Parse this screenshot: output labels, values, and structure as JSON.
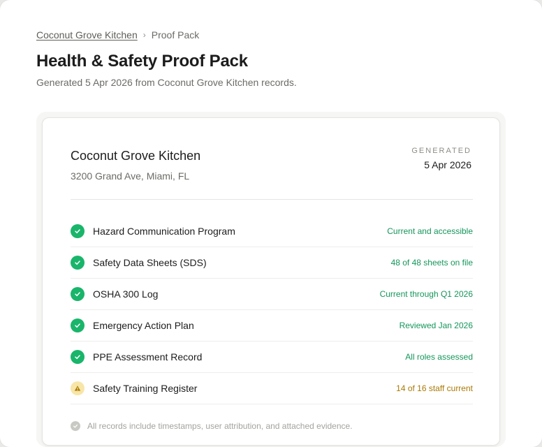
{
  "breadcrumb": {
    "parent": "Coconut Grove Kitchen",
    "separator": "›",
    "current": "Proof Pack"
  },
  "header": {
    "title": "Health & Safety Proof Pack",
    "subtitle": "Generated 5 Apr 2026 from Coconut Grove Kitchen records."
  },
  "card": {
    "name": "Coconut Grove Kitchen",
    "address": "3200 Grand Ave, Miami, FL",
    "generated_label": "GENERATED",
    "generated_date": "5 Apr 2026",
    "items": [
      {
        "label": "Hazard Communication Program",
        "status": "Current and accessible",
        "state": "ok",
        "icon": "check-icon"
      },
      {
        "label": "Safety Data Sheets (SDS)",
        "status": "48 of 48 sheets on file",
        "state": "ok",
        "icon": "check-icon"
      },
      {
        "label": "OSHA 300 Log",
        "status": "Current through Q1 2026",
        "state": "ok",
        "icon": "check-icon"
      },
      {
        "label": "Emergency Action Plan",
        "status": "Reviewed Jan 2026",
        "state": "ok",
        "icon": "check-icon"
      },
      {
        "label": "PPE Assessment Record",
        "status": "All roles assessed",
        "state": "ok",
        "icon": "check-icon"
      },
      {
        "label": "Safety Training Register",
        "status": "14 of 16 staff current",
        "state": "warn",
        "icon": "warning-icon"
      }
    ],
    "footnote": "All records include timestamps, user attribution, and attached evidence."
  },
  "colors": {
    "ok": "#19b56a",
    "ok_text": "#14965a",
    "warn_bg": "#f7e6a8",
    "warn_text": "#a97a06"
  }
}
